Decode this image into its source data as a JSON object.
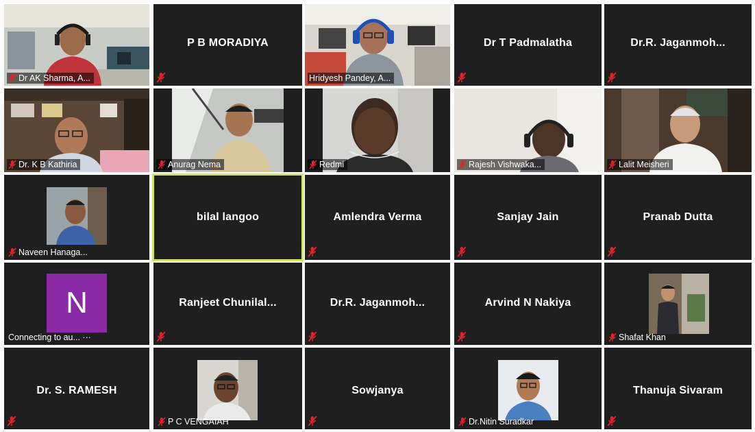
{
  "app": "Zoom Gallery View",
  "participants": [
    {
      "name": "Dr AK Sharma, A...",
      "type": "video",
      "muted": true
    },
    {
      "name": "P B MORADIYA",
      "type": "name",
      "muted": true
    },
    {
      "name": "Hridyesh Pandey, A...",
      "type": "video",
      "muted": false
    },
    {
      "name": "Dr T Padmalatha",
      "type": "name",
      "muted": true
    },
    {
      "name": "Dr.R. Jaganmoh...",
      "type": "name",
      "muted": true
    },
    {
      "name": "Dr. K B Kathiria",
      "type": "video",
      "muted": true
    },
    {
      "name": "Anurag Nema",
      "type": "video",
      "muted": true
    },
    {
      "name": "Redmi",
      "type": "video",
      "muted": true
    },
    {
      "name": "Rajesh Vishwaka...",
      "type": "video",
      "muted": true
    },
    {
      "name": "Lalit Meisheri",
      "type": "video",
      "muted": true
    },
    {
      "name": "Naveen Hanaga...",
      "type": "photo",
      "muted": true
    },
    {
      "name": "bilal langoo",
      "type": "name",
      "muted": false,
      "active_speaker": true
    },
    {
      "name": "Amlendra Verma",
      "type": "name",
      "muted": true
    },
    {
      "name": "Sanjay Jain",
      "type": "name",
      "muted": true
    },
    {
      "name": "Pranab Dutta",
      "type": "name",
      "muted": true
    },
    {
      "name": "Connecting to au... ···",
      "type": "avatar",
      "avatar_letter": "N",
      "muted": false
    },
    {
      "name": "Ranjeet  Chunilal...",
      "type": "name",
      "muted": true
    },
    {
      "name": "Dr.R. Jaganmoh...",
      "type": "name",
      "muted": true
    },
    {
      "name": "Arvind N Nakiya",
      "type": "name",
      "muted": true
    },
    {
      "name": "Shafat Khan",
      "type": "photo",
      "muted": true
    },
    {
      "name": "Dr. S. RAMESH",
      "type": "name",
      "muted": true
    },
    {
      "name": "P C VENGAIAH",
      "type": "photo",
      "muted": true
    },
    {
      "name": "Sowjanya",
      "type": "name",
      "muted": true
    },
    {
      "name": "Dr.Nitin Suradkar",
      "type": "photo",
      "muted": true
    },
    {
      "name": "Thanuja Sivaram",
      "type": "name",
      "muted": true
    }
  ],
  "colors": {
    "tile_bg": "#1f1f1f",
    "active_border": "#d3e26a",
    "mute_icon": "#e0222a",
    "avatar_bg": "#8b2aa6"
  }
}
